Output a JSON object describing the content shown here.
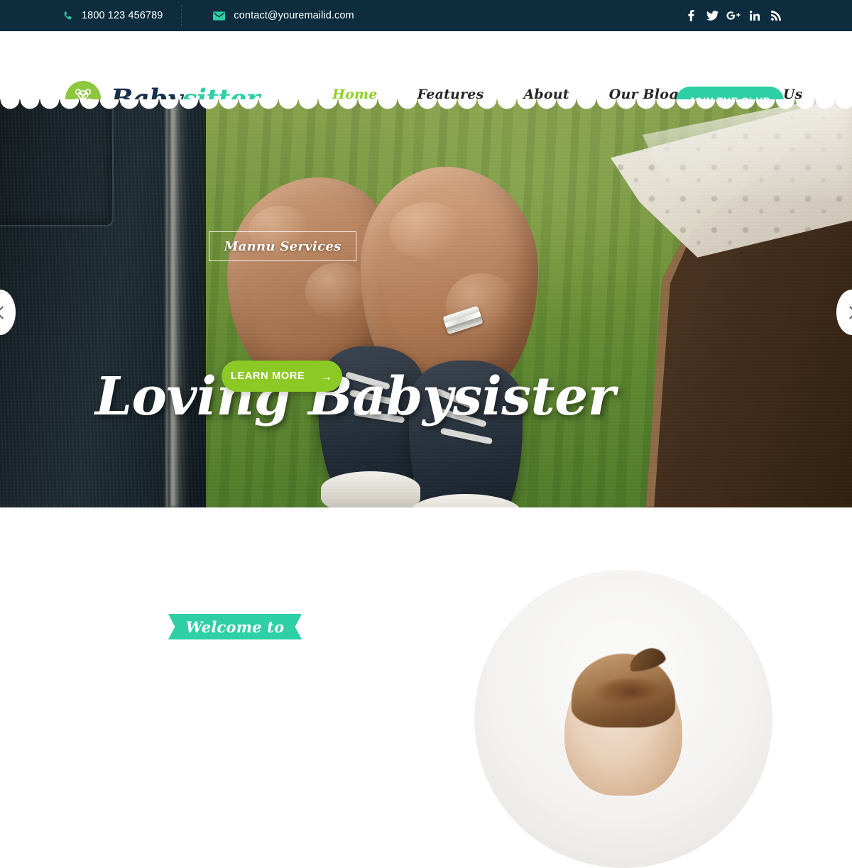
{
  "topbar": {
    "phone": "1800 123 456789",
    "phone_icon": "phone-icon",
    "email": "contact@youremailid.com",
    "email_icon": "envelope-icon",
    "socials": [
      {
        "name": "facebook-icon",
        "label": "f"
      },
      {
        "name": "twitter-icon",
        "label": "t"
      },
      {
        "name": "google-plus-icon",
        "label": "G+"
      },
      {
        "name": "linkedin-icon",
        "label": "in"
      },
      {
        "name": "rss-icon",
        "label": "rss"
      }
    ],
    "background_color": "#0d2d3f",
    "icon_color": "#2ecfa4"
  },
  "header": {
    "logo": {
      "icon": "teddy-bear-icon",
      "text_primary": "Baby",
      "text_secondary": "sitter",
      "badge_color": "#8dc63f",
      "primary_color": "#17304a",
      "secondary_color": "#2ecfa4"
    },
    "nav": [
      {
        "label": "Home",
        "active": true
      },
      {
        "label": "Features",
        "active": false
      },
      {
        "label": "About",
        "active": false
      },
      {
        "label": "Our Blog",
        "active": false
      },
      {
        "label": "Contact Us",
        "active": false
      }
    ],
    "cta_label": "JOIN THE CLUB",
    "cta_color": "#2ecfa4",
    "active_color": "#8ed129"
  },
  "hero": {
    "eyebrow": "Mannu Services",
    "title": "Loving Babysister",
    "button_label": "LEARN MORE",
    "button_arrow": "→",
    "button_color": "#8dc925",
    "prev_label": "‹",
    "next_label": "›",
    "image_description": "hands holding baby shoes"
  },
  "welcome": {
    "ribbon_label": "Welcome to",
    "ribbon_color": "#2ecfa4",
    "image_description": "baby portrait in circle"
  }
}
